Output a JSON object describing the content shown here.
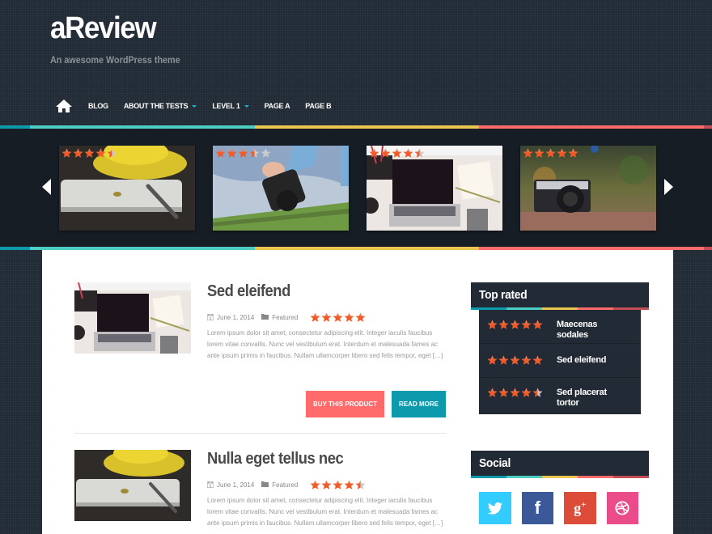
{
  "site": {
    "title": "aReview",
    "tagline": "An awesome WordPress theme"
  },
  "nav": {
    "home_icon": "home-icon",
    "items": [
      {
        "label": "BLOG",
        "has_dropdown": false
      },
      {
        "label": "ABOUT THE TESTS",
        "has_dropdown": true
      },
      {
        "label": "LEVEL 1",
        "has_dropdown": true
      },
      {
        "label": "PAGE A",
        "has_dropdown": false
      },
      {
        "label": "PAGE B",
        "has_dropdown": false
      }
    ]
  },
  "colors": {
    "teal_dark": "#0d9aac",
    "teal": "#4ecdc4",
    "yellow": "#eac54f",
    "coral": "#ff6b6b",
    "red_dark": "#c44d58",
    "buy_button": "#ff6b6b",
    "read_more_button": "#0d9aac",
    "twitter": "#33ccff",
    "facebook": "#3b5998",
    "google_plus": "#dd4b39",
    "dribbble": "#ea4c89"
  },
  "slider": {
    "prev_icon": "chevron-left-icon",
    "next_icon": "chevron-right-icon",
    "slides": [
      {
        "subject": "tablet-and-yellow-cup",
        "rating": 4.5
      },
      {
        "subject": "hand-holding-camera",
        "rating": 3.5
      },
      {
        "subject": "laptop-desk",
        "rating": 4.5
      },
      {
        "subject": "vintage-camera",
        "rating": 5
      }
    ]
  },
  "posts": [
    {
      "title": "Sed eleifend",
      "date": "June 1, 2014",
      "category": "Featured",
      "rating": 5,
      "excerpt": "Lorem ipsum dolor sit amet, consectetur adipiscing elit. Integer iaculis faucibus lorem vitae convallis. Nunc vel vestibulum erat. Interdum et malesuada fames ac ante ipsum primis in faucibus. Nullam ullamcorper libero sed felis tempor, eget […]",
      "buy_label": "BUY THIS PRODUCT",
      "read_more_label": "READ MORE"
    },
    {
      "title": "Nulla eget tellus nec",
      "date": "June 1, 2014",
      "category": "Featured",
      "rating": 4.5,
      "excerpt": "Lorem ipsum dolor sit amet, consectetur adipiscing elit. Integer iaculis faucibus lorem vitae convallis. Nunc vel vestibulum erat. Interdum et malesuada fames ac ante ipsum primis in faucibus. Nullam ullamcorper libero sed felis tempor, eget […]"
    }
  ],
  "sidebar": {
    "top_rated": {
      "title": "Top rated",
      "items": [
        {
          "name": "Maecenas sodales",
          "rating": 5
        },
        {
          "name": "Sed eleifend",
          "rating": 5
        },
        {
          "name": "Sed placerat tortor",
          "rating": 4.5
        }
      ]
    },
    "social": {
      "title": "Social",
      "links": [
        {
          "network": "twitter",
          "icon": "twitter-icon"
        },
        {
          "network": "facebook",
          "icon": "facebook-icon"
        },
        {
          "network": "google-plus",
          "icon": "google-plus-icon"
        },
        {
          "network": "dribbble",
          "icon": "dribbble-icon"
        }
      ]
    }
  }
}
